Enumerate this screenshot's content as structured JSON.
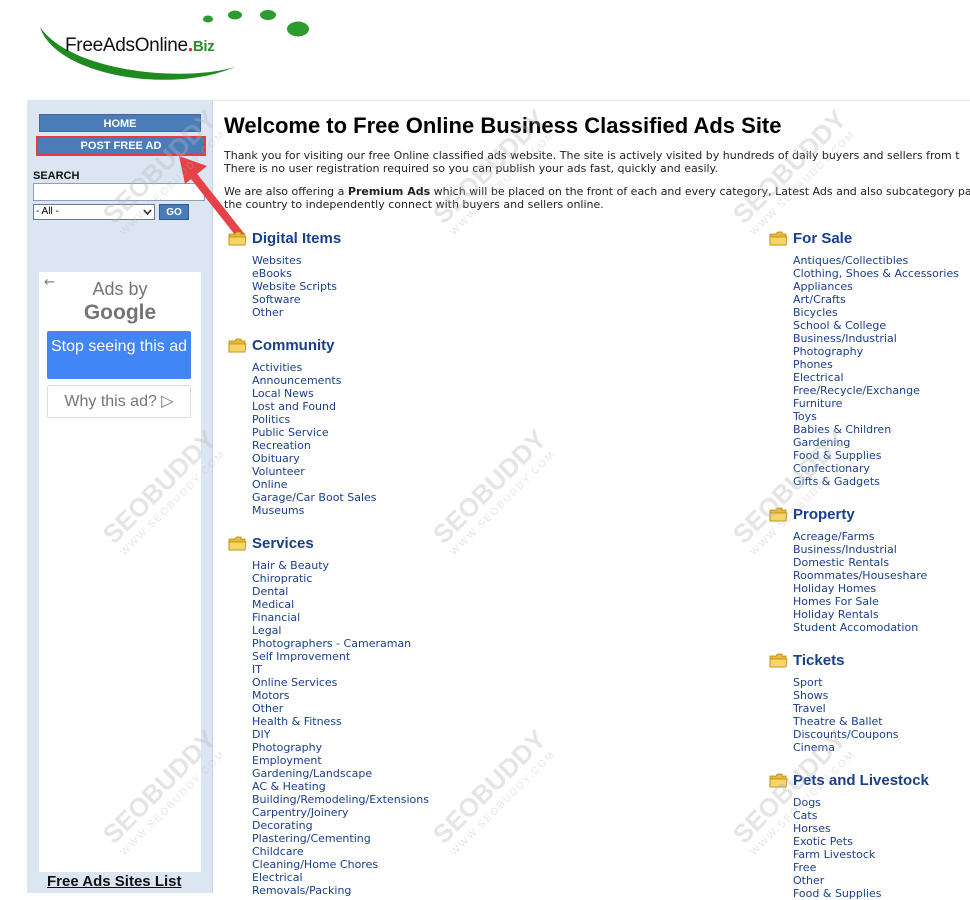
{
  "logo": {
    "text_main": "FreeAdsOnline",
    "text_dot": ".",
    "text_biz": "Biz"
  },
  "sidebar": {
    "home_label": "HOME",
    "post_label": "POST FREE AD",
    "search_label": "SEARCH",
    "search_value": "",
    "category_selected": "- All -",
    "go_label": "GO",
    "footer_link": "Free Ads Sites List"
  },
  "ad": {
    "by_label": "Ads by",
    "brand_label": "Google",
    "stop_label": "Stop seeing this ad",
    "why_label": "Why this ad? ▷"
  },
  "main": {
    "title": "Welcome to Free Online Business Classified Ads Site",
    "intro_line1": "Thank you for visiting our free Online classified ads website. The site is actively visited by hundreds of daily buyers and sellers from t",
    "intro_line2": "There is no user registration required so you can publish your ads fast, quickly and easily.",
    "intro_line3_pre": "We are also offering a ",
    "intro_line3_bold": "Premium Ads",
    "intro_line3_post": " which will be placed on the front of each and every category, Latest Ads and also subcategory pa",
    "intro_line4": "the country to independently connect with buyers and sellers online."
  },
  "categories": {
    "digital": {
      "title": "Digital Items",
      "items": [
        "Websites",
        "eBooks",
        "Website Scripts",
        "Software",
        "Other"
      ]
    },
    "community": {
      "title": "Community",
      "items": [
        "Activities",
        "Announcements",
        "Local News",
        "Lost and Found",
        "Politics",
        "Public Service",
        "Recreation",
        "Obituary",
        "Volunteer",
        "Online",
        "Garage/Car Boot Sales",
        "Museums"
      ]
    },
    "services": {
      "title": "Services",
      "items": [
        "Hair & Beauty",
        "Chiropratic",
        "Dental",
        "Medical",
        "Financial",
        "Legal",
        "Photographers - Cameraman",
        "Self Improvement",
        "IT",
        "Online Services",
        "Motors",
        "Other",
        "Health & Fitness",
        "DIY",
        "Photography",
        "Employment",
        "Gardening/Landscape",
        "AC & Heating",
        "Building/Remodeling/Extensions",
        "Carpentry/Joinery",
        "Decorating",
        "Plastering/Cementing",
        "Childcare",
        "Cleaning/Home Chores",
        "Electrical",
        "Removals/Packing"
      ]
    },
    "forsale": {
      "title": "For Sale",
      "items": [
        "Antiques/Collectibles",
        "Clothing, Shoes & Accessories",
        "Appliances",
        "Art/Crafts",
        "Bicycles",
        "School & College",
        "Business/Industrial",
        "Photography",
        "Phones",
        "Electrical",
        "Free/Recycle/Exchange",
        "Furniture",
        "Toys",
        "Babies & Children",
        "Gardening",
        "Food & Supplies",
        "Confectionary",
        "Gifts & Gadgets"
      ]
    },
    "property": {
      "title": "Property",
      "items": [
        "Acreage/Farms",
        "Business/Industrial",
        "Domestic Rentals",
        "Roommates/Houseshare",
        "Holiday Homes",
        "Homes For Sale",
        "Holiday Rentals",
        "Student Accomodation"
      ]
    },
    "tickets": {
      "title": "Tickets",
      "items": [
        "Sport",
        "Shows",
        "Travel",
        "Theatre & Ballet",
        "Discounts/Coupons",
        "Cinema"
      ]
    },
    "pets": {
      "title": "Pets and Livestock",
      "items": [
        "Dogs",
        "Cats",
        "Horses",
        "Exotic Pets",
        "Farm Livestock",
        "Free",
        "Other",
        "Food & Supplies"
      ]
    }
  },
  "watermark": {
    "brand": "SEOBUDDY",
    "url": "WWW.SEOBUDDY.COM"
  },
  "colors": {
    "nav_blue": "#4a7db8",
    "link_blue": "#1a3f8a",
    "sidebar_bg": "#dce6f3",
    "highlight_red": "#e83c3c"
  }
}
